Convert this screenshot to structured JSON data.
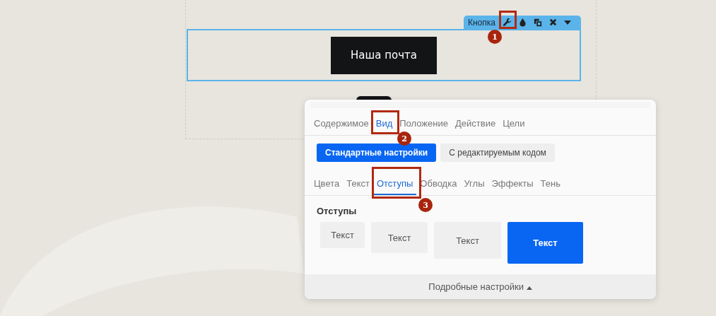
{
  "element_toolbar": {
    "label": "Кнопка"
  },
  "canvas_button": {
    "label": "Наша почта"
  },
  "panel": {
    "tabs": [
      {
        "label": "Содержимое",
        "selected": false
      },
      {
        "label": "Вид",
        "selected": true
      },
      {
        "label": "Положение",
        "selected": false
      },
      {
        "label": "Действие",
        "selected": false
      },
      {
        "label": "Цели",
        "selected": false
      }
    ],
    "modes": [
      {
        "label": "Стандартные настройки",
        "selected": true
      },
      {
        "label": "С редактируемым кодом",
        "selected": false
      }
    ],
    "subtabs": [
      {
        "label": "Цвета",
        "selected": false
      },
      {
        "label": "Текст",
        "selected": false
      },
      {
        "label": "Отступы",
        "selected": true
      },
      {
        "label": "Обводка",
        "selected": false
      },
      {
        "label": "Углы",
        "selected": false
      },
      {
        "label": "Эффекты",
        "selected": false
      },
      {
        "label": "Тень",
        "selected": false
      }
    ],
    "section_title": "Отступы",
    "padding_options": [
      {
        "label": "Текст",
        "selected": false
      },
      {
        "label": "Текст",
        "selected": false
      },
      {
        "label": "Текст",
        "selected": false
      },
      {
        "label": "Текст",
        "selected": true
      }
    ],
    "footer": {
      "label": "Подробные настройки"
    }
  },
  "annotations": [
    {
      "number": "1"
    },
    {
      "number": "2"
    },
    {
      "number": "3"
    }
  ]
}
